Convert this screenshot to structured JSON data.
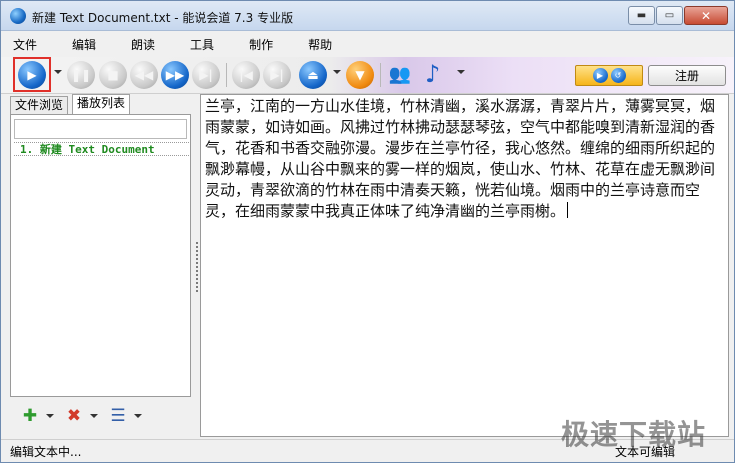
{
  "window": {
    "title": "新建 Text Document.txt - 能说会道 7.3 专业版"
  },
  "menu": [
    "文件",
    "编辑",
    "朗读",
    "工具",
    "制作",
    "帮助"
  ],
  "toolbar": {
    "play_glyph": "▶",
    "pause_glyph": "❚❚",
    "stop_glyph": "■",
    "prev_glyph": "◀◀",
    "next_glyph": "▶▶",
    "end_glyph": "▶|",
    "first_glyph": "|◀",
    "last_glyph": "▶|",
    "eject_glyph": "⏏",
    "down_glyph": "▼",
    "users_glyph": "👥",
    "note_glyph": "♪",
    "nav_left": "▶",
    "nav_right": "↺",
    "register_label": "注册"
  },
  "sidebar": {
    "tabs": [
      "文件浏览",
      "播放列表"
    ],
    "active_tab": "播放列表",
    "playlist": [
      "1. 新建 Text Document"
    ],
    "tools": {
      "add_glyph": "✚",
      "remove_glyph": "✖",
      "list_glyph": "☰"
    }
  },
  "editor": {
    "text": "兰亭，江南的一方山水佳境，竹林清幽，溪水潺潺，青翠片片，薄雾冥冥，烟雨蒙蒙，如诗如画。风拂过竹林拂动瑟瑟琴弦，空气中都能嗅到清新湿润的香气，花香和书香交融弥漫。漫步在兰亭竹径，我心悠然。缠绵的细雨所织起的飘渺幕幔，从山谷中飘来的雾一样的烟岚，使山水、竹林、花草在虚无飘渺间灵动，青翠欲滴的竹林在雨中清奏天籁，恍若仙境。烟雨中的兰亭诗意而空灵，在细雨蒙蒙中我真正体味了纯净清幽的兰亭雨榭。"
  },
  "status": {
    "left": "编辑文本中...",
    "right": "文本可编辑"
  },
  "watermark": "极速下载站",
  "colors": {
    "accent_blue": "#1466c9",
    "highlight_red": "#e0302a",
    "playlist_green": "#1f8a1f"
  }
}
